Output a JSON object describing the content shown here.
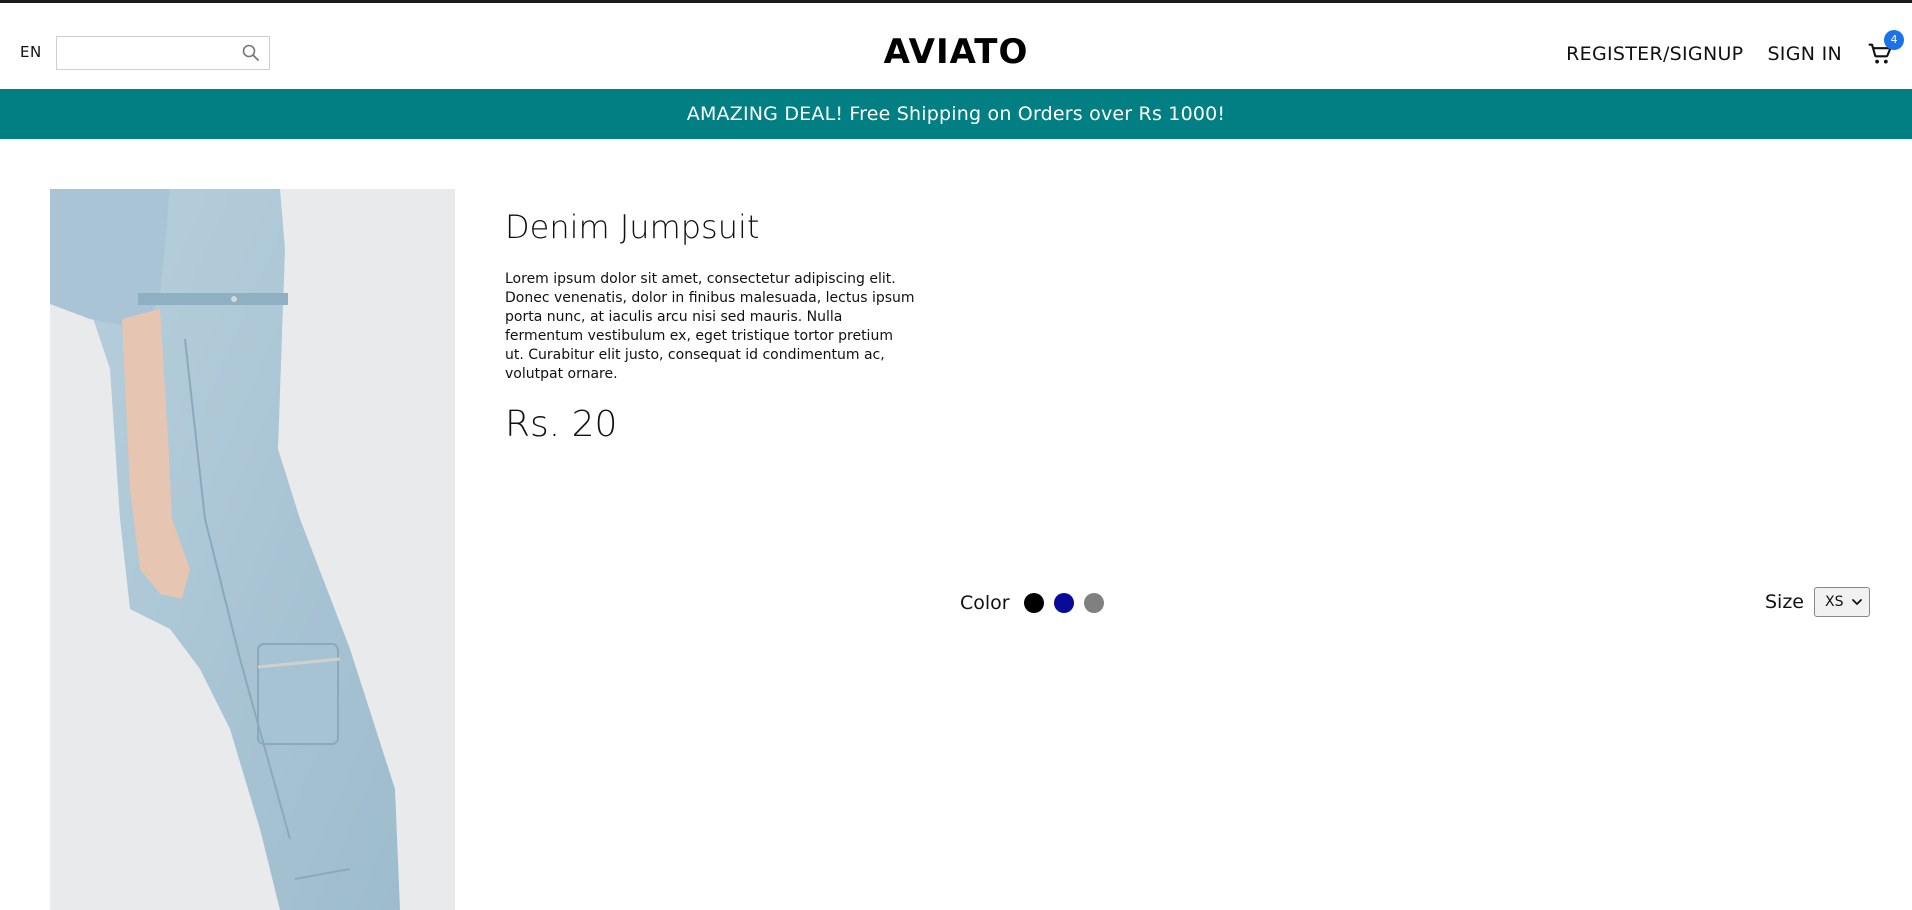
{
  "header": {
    "lang": "EN",
    "search_placeholder": "",
    "logo": "AVIATO",
    "nav": {
      "register": "REGISTER/SIGNUP",
      "signin": "SIGN IN"
    },
    "cart": {
      "count": "4",
      "icon": "cart-icon"
    },
    "search_icon": "search-icon"
  },
  "banner": {
    "text": "AMAZING DEAL! Free Shipping on Orders over Rs 1000!",
    "color": "#027f82"
  },
  "product": {
    "image_alt": "product-image",
    "title": "Denim Jumpsuit",
    "description": "Lorem ipsum dolor sit amet, consectetur adipiscing elit. Donec venenatis, dolor in finibus malesuada, lectus ipsum porta nunc, at iaculis arcu nisi sed mauris. Nulla fermentum vestibulum ex, eget tristique tortor pretium ut. Curabitur elit justo, consequat id condimentum ac, volutpat ornare.",
    "price": "Rs. 20",
    "color_label": "Color",
    "colors": [
      "#000000",
      "#0a0a9a",
      "#808080"
    ],
    "size_label": "Size",
    "size_selected": "XS"
  }
}
